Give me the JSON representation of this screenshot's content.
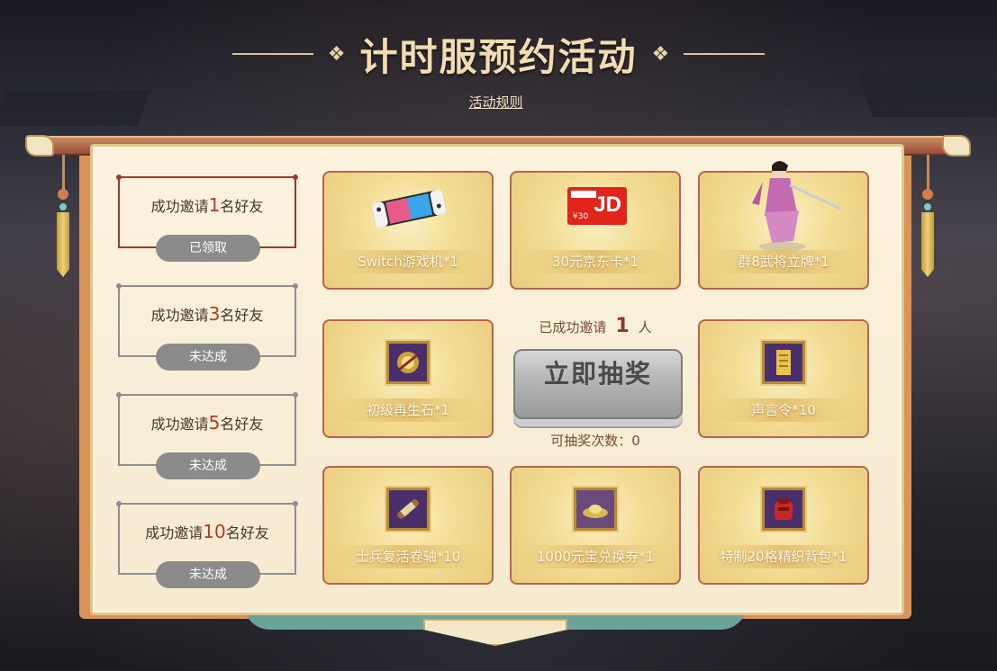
{
  "header": {
    "title": "计时服预约活动",
    "rules_link": "活动规则"
  },
  "tiers": [
    {
      "prefix": "成功邀请",
      "num": "1",
      "suffix": "名好友",
      "status": "已领取",
      "active": true
    },
    {
      "prefix": "成功邀请",
      "num": "3",
      "suffix": "名好友",
      "status": "未达成",
      "active": false
    },
    {
      "prefix": "成功邀请",
      "num": "5",
      "suffix": "名好友",
      "status": "未达成",
      "active": false
    },
    {
      "prefix": "成功邀请",
      "num": "10",
      "suffix": "名好友",
      "status": "未达成",
      "active": false
    }
  ],
  "prizes": [
    {
      "label": "Switch游戏机*1",
      "icon": "switch-console-icon"
    },
    {
      "label": "30元京东卡*1",
      "icon": "jd-card-icon"
    },
    {
      "label": "群8武将立牌*1",
      "icon": "general-figure-icon"
    },
    {
      "label": "初级再生石*1",
      "icon": "regen-stone-icon"
    },
    {
      "label": "声言令*10",
      "icon": "scroll-token-icon"
    },
    {
      "label": "士兵复活卷轴*10",
      "icon": "revive-scroll-icon"
    },
    {
      "label": "1000元宝兑换券*1",
      "icon": "ingot-voucher-icon"
    },
    {
      "label": "特制20格精织背包*1",
      "icon": "backpack-icon"
    }
  ],
  "draw": {
    "invited_prefix": "已成功邀请",
    "invited_count": "1",
    "invited_suffix": "人",
    "button_label": "立即抽奖",
    "remaining_label": "可抽奖次数：",
    "remaining_count": "0"
  },
  "jd_card": {
    "brand": "JD",
    "amount": "¥30"
  }
}
